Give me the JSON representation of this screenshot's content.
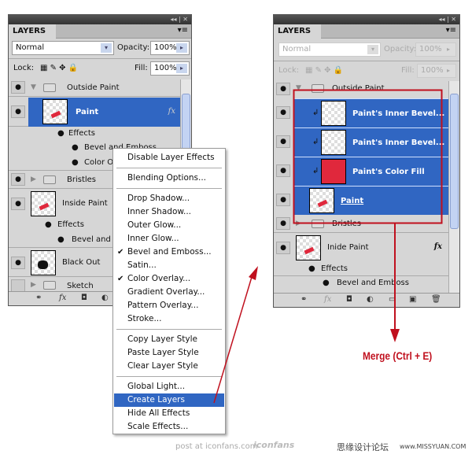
{
  "left_panel": {
    "title_controls": "◂◂ | ✕",
    "tab": "LAYERS",
    "blend_mode": "Normal",
    "opacity_label": "Opacity:",
    "opacity": "100%",
    "lock_label": "Lock:",
    "fill_label": "Fill:",
    "fill": "100%",
    "layers": [
      {
        "name": "Outside Paint",
        "type": "group",
        "expanded": true
      },
      {
        "name": "Paint",
        "selected": true,
        "fx": "fx"
      },
      {
        "name": "Effects"
      },
      {
        "name": "Bevel and Emboss"
      },
      {
        "name": "Color Overlay"
      },
      {
        "name": "Bristles",
        "type": "group"
      },
      {
        "name": "Inside Paint"
      },
      {
        "name": "Effects"
      },
      {
        "name": "Bevel and Emboss"
      },
      {
        "name": "Black Out"
      },
      {
        "name": "Sketch",
        "type": "group"
      }
    ]
  },
  "context_menu": {
    "items": [
      "Disable Layer Effects",
      "Blending Options...",
      "Drop Shadow...",
      "Inner Shadow...",
      "Outer Glow...",
      "Inner Glow...",
      "Bevel and Emboss...",
      "Satin...",
      "Color Overlay...",
      "Gradient Overlay...",
      "Pattern Overlay...",
      "Stroke...",
      "Copy Layer Style",
      "Paste Layer Style",
      "Clear Layer Style",
      "Global Light...",
      "Create Layers",
      "Hide All Effects",
      "Scale Effects..."
    ],
    "checked": [
      "Bevel and Emboss...",
      "Color Overlay..."
    ],
    "highlighted": "Create Layers"
  },
  "right_panel": {
    "title_controls": "◂◂ | ✕",
    "tab": "LAYERS",
    "blend_mode": "Normal",
    "opacity_label": "Opacity:",
    "opacity": "100%",
    "lock_label": "Lock:",
    "fill_label": "Fill:",
    "fill": "100%",
    "layers": [
      {
        "name": "Outside Paint",
        "type": "group"
      },
      {
        "name": "Paint's Inner Bevel...",
        "selected": true
      },
      {
        "name": "Paint's Inner Bevel...",
        "selected": true
      },
      {
        "name": "Paint's Color Fill",
        "selected": true
      },
      {
        "name": "Paint",
        "selected": true
      },
      {
        "name": "Bristles",
        "type": "group"
      },
      {
        "name": "Inide Paint",
        "fx": "fx"
      },
      {
        "name": "Effects"
      },
      {
        "name": "Bevel and Emboss"
      }
    ]
  },
  "annotation": {
    "merge": "Merge (Ctrl + E)",
    "color": "#c0101e"
  },
  "footer": {
    "post_at": "post at iconfans.com",
    "logo": "iconfans",
    "cn_site": "思缘设计论坛",
    "url": "www.MISSYUAN.COM"
  },
  "colors": {
    "selection": "#3066c2",
    "panel": "#d6d6d6",
    "paint_red": "#e0283c"
  }
}
